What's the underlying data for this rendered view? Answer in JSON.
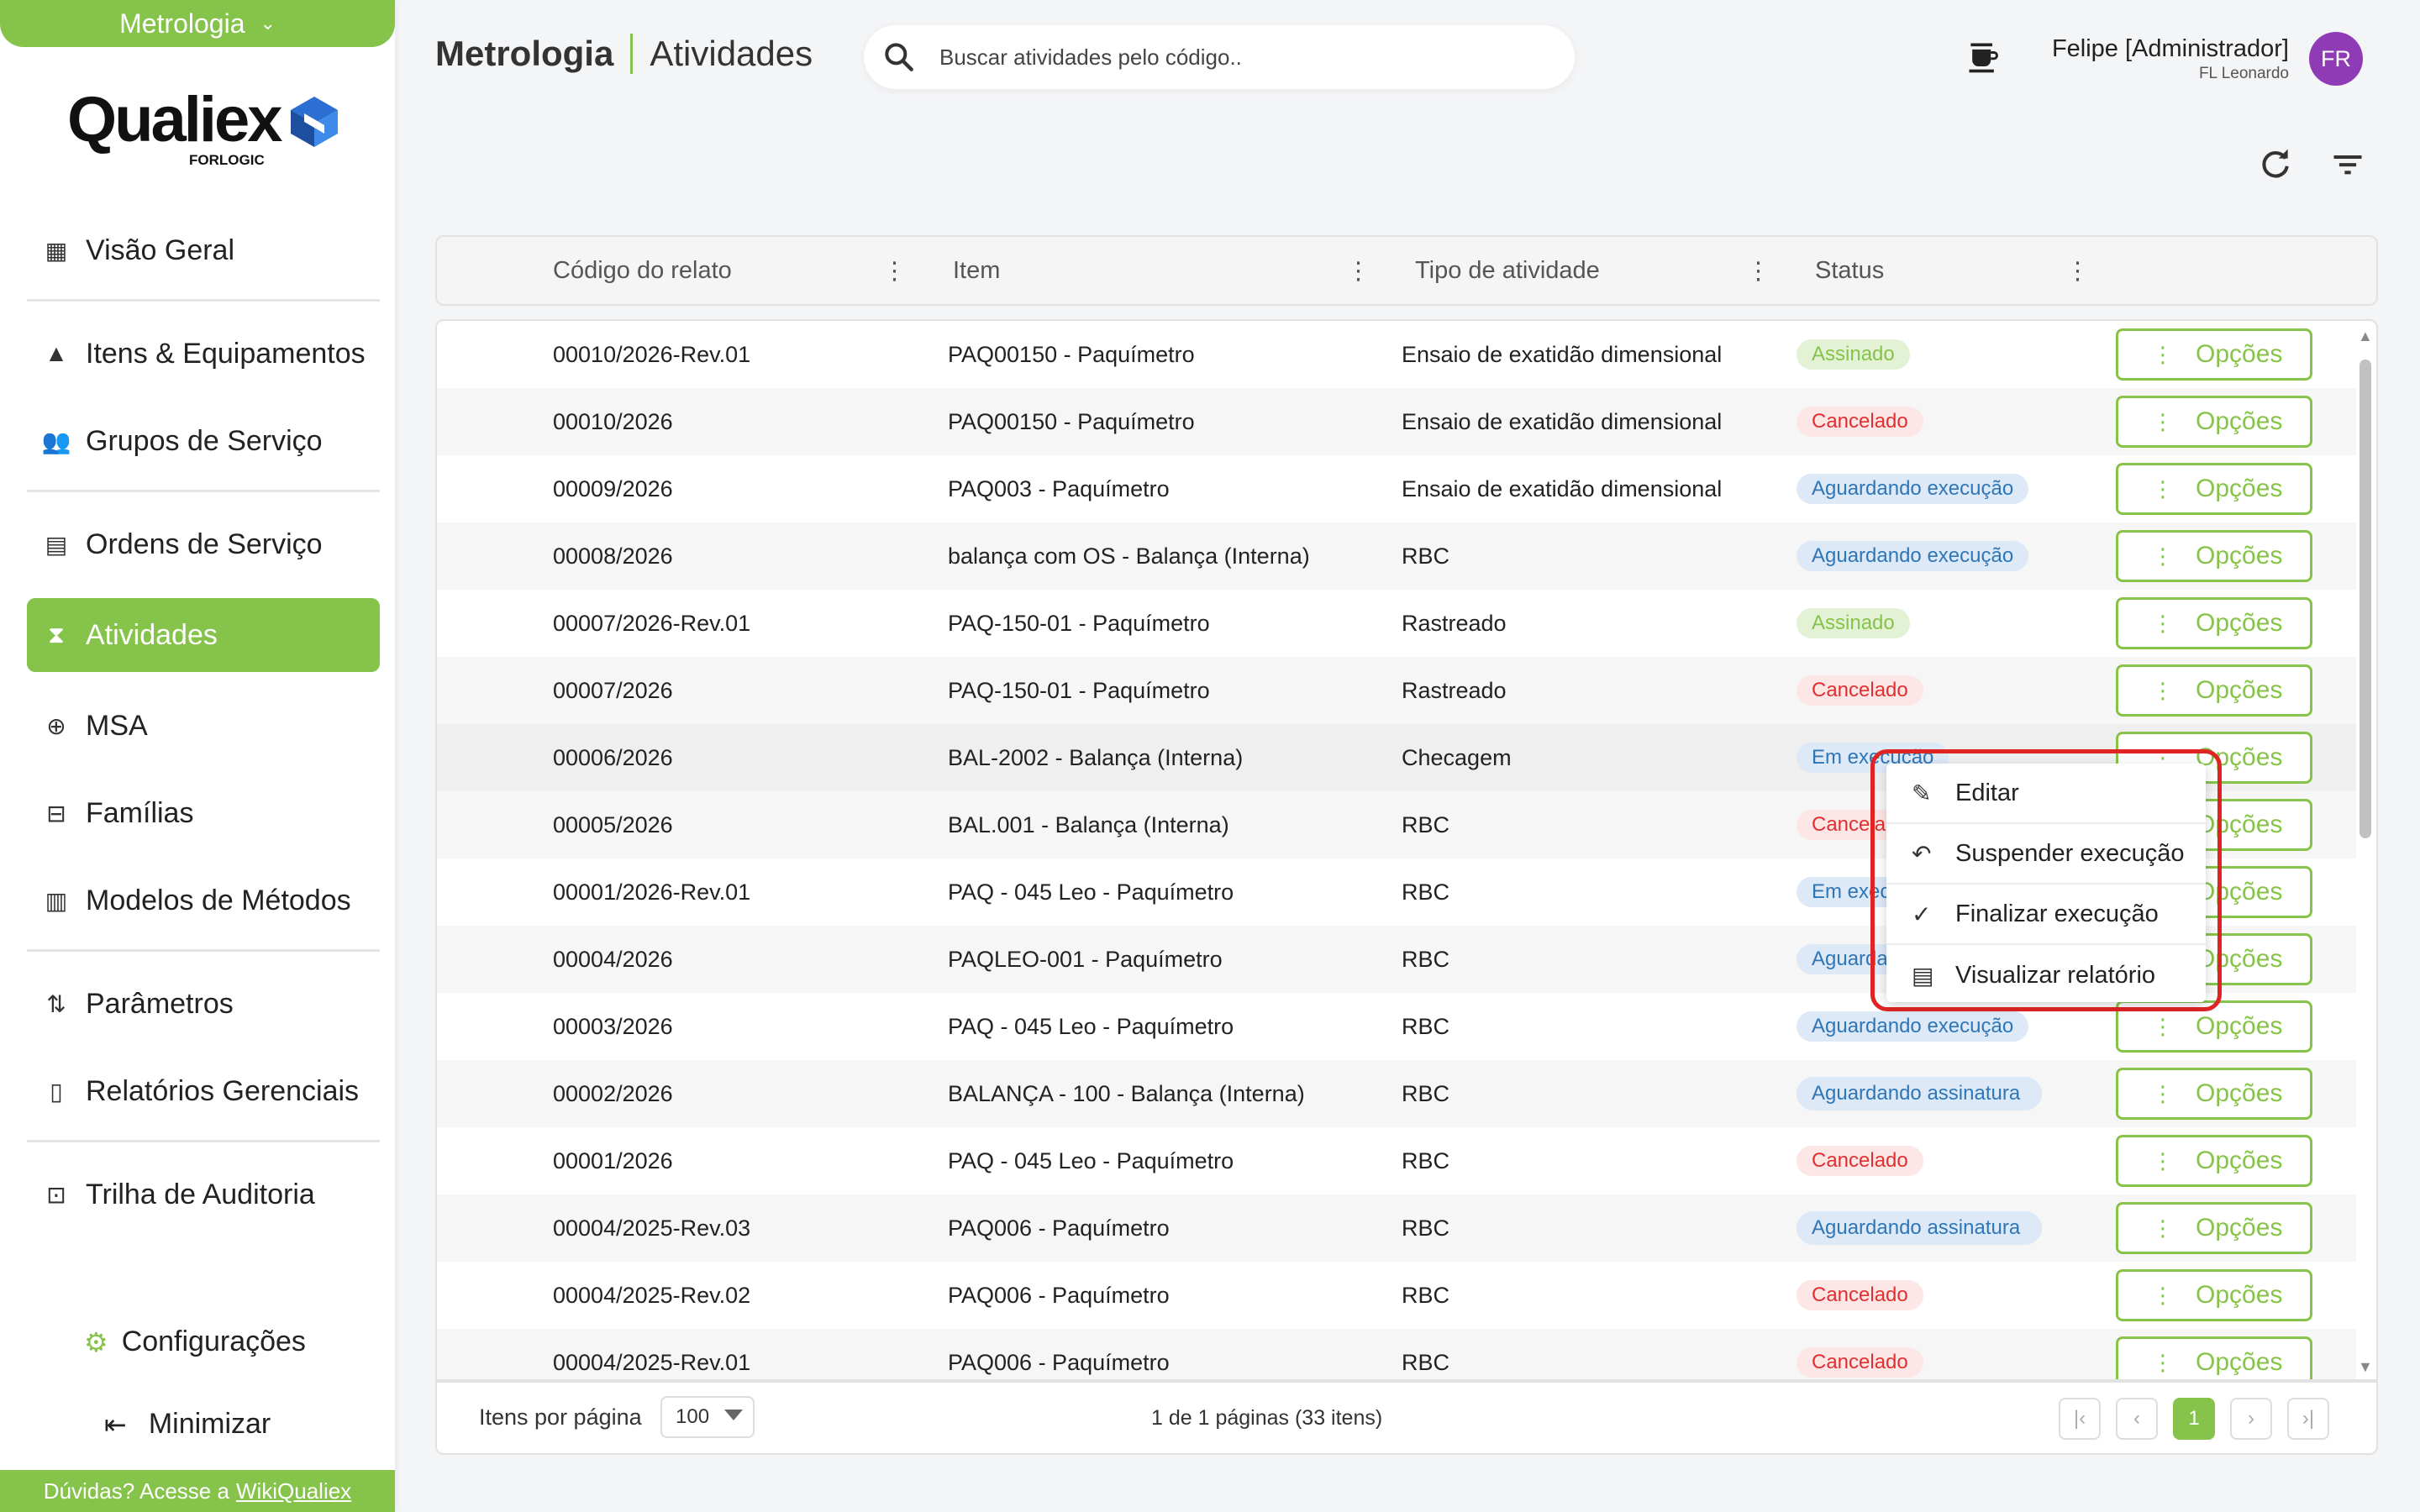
{
  "sidebar": {
    "module": "Metrologia",
    "logo": {
      "name": "Qualiex",
      "sub": "FORLOGIC"
    },
    "groups": [
      [
        {
          "label": "Visão Geral",
          "icon": "dashboard-icon"
        }
      ],
      [
        {
          "label": "Itens & Equipamentos",
          "icon": "shapes-icon"
        },
        {
          "label": "Grupos de Serviço",
          "icon": "group-icon"
        }
      ],
      [
        {
          "label": "Ordens de Serviço",
          "icon": "document-icon"
        },
        {
          "label": "Atividades",
          "icon": "hourglass-icon",
          "active": true
        },
        {
          "label": "MSA",
          "icon": "zoom-icon"
        },
        {
          "label": "Famílias",
          "icon": "toolbox-icon"
        },
        {
          "label": "Modelos de Métodos",
          "icon": "library-icon"
        }
      ],
      [
        {
          "label": "Parâmetros",
          "icon": "sliders-icon"
        },
        {
          "label": "Relatórios Gerenciais",
          "icon": "report-icon"
        }
      ],
      [
        {
          "label": "Trilha de Auditoria",
          "icon": "audit-icon"
        }
      ]
    ],
    "config_label": "Configurações",
    "minimize_label": "Minimizar",
    "help_text": "Dúvidas? Acesse a",
    "help_link": "WikiQualiex"
  },
  "header": {
    "module": "Metrologia",
    "page": "Atividades",
    "search_placeholder": "Buscar atividades pelo código..",
    "user_name": "Felipe [Administrador]",
    "user_org": "FL Leonardo",
    "avatar_initials": "FR"
  },
  "table": {
    "columns": [
      "Código do relato",
      "Item",
      "Tipo de atividade",
      "Status"
    ],
    "options_label": "Opções",
    "rows": [
      {
        "code": "00010/2026-Rev.01",
        "item": "PAQ00150 - Paquímetro",
        "type": "Ensaio de exatidão dimensional",
        "status": "Assinado",
        "kind": "signed"
      },
      {
        "code": "00010/2026",
        "item": "PAQ00150 - Paquímetro",
        "type": "Ensaio de exatidão dimensional",
        "status": "Cancelado",
        "kind": "cancel"
      },
      {
        "code": "00009/2026",
        "item": "PAQ003 - Paquímetro",
        "type": "Ensaio de exatidão dimensional",
        "status": "Aguardando execução",
        "kind": "waiting"
      },
      {
        "code": "00008/2026",
        "item": "balança com OS - Balança (Interna)",
        "type": "RBC",
        "status": "Aguardando execução",
        "kind": "waiting"
      },
      {
        "code": "00007/2026-Rev.01",
        "item": "PAQ-150-01 - Paquímetro",
        "type": "Rastreado",
        "status": "Assinado",
        "kind": "signed"
      },
      {
        "code": "00007/2026",
        "item": "PAQ-150-01 - Paquímetro",
        "type": "Rastreado",
        "status": "Cancelado",
        "kind": "cancel"
      },
      {
        "code": "00006/2026",
        "item": "BAL-2002 - Balança (Interna)",
        "type": "Checagem",
        "status": "Em execução",
        "kind": "running"
      },
      {
        "code": "00005/2026",
        "item": "BAL.001 - Balança (Interna)",
        "type": "RBC",
        "status": "Cancelado",
        "kind": "cancel"
      },
      {
        "code": "00001/2026-Rev.01",
        "item": "PAQ - 045 Leo - Paquímetro",
        "type": "RBC",
        "status": "Em execução",
        "kind": "running"
      },
      {
        "code": "00004/2026",
        "item": "PAQLEO-001 - Paquímetro",
        "type": "RBC",
        "status": "Aguardando execução",
        "kind": "waiting"
      },
      {
        "code": "00003/2026",
        "item": "PAQ - 045 Leo - Paquímetro",
        "type": "RBC",
        "status": "Aguardando execução",
        "kind": "waiting"
      },
      {
        "code": "00002/2026",
        "item": "BALANÇA - 100 - Balança (Interna)",
        "type": "RBC",
        "status": "Aguardando assinatura",
        "kind": "waiting2"
      },
      {
        "code": "00001/2026",
        "item": "PAQ - 045 Leo - Paquímetro",
        "type": "RBC",
        "status": "Cancelado",
        "kind": "cancel"
      },
      {
        "code": "00004/2025-Rev.03",
        "item": "PAQ006 - Paquímetro",
        "type": "RBC",
        "status": "Aguardando assinatura",
        "kind": "waiting2"
      },
      {
        "code": "00004/2025-Rev.02",
        "item": "PAQ006 - Paquímetro",
        "type": "RBC",
        "status": "Cancelado",
        "kind": "cancel"
      },
      {
        "code": "00004/2025-Rev.01",
        "item": "PAQ006 - Paquímetro",
        "type": "RBC",
        "status": "Cancelado",
        "kind": "cancel"
      }
    ]
  },
  "context_menu": {
    "items": [
      {
        "label": "Editar",
        "icon": "pencil-icon"
      },
      {
        "label": "Suspender execução",
        "icon": "undo-icon"
      },
      {
        "label": "Finalizar execução",
        "icon": "check-icon"
      },
      {
        "label": "Visualizar relatório",
        "icon": "clipboard-icon"
      }
    ]
  },
  "footer": {
    "items_per_page_label": "Itens por página",
    "items_per_page": "100",
    "page_info": "1 de 1 páginas (33 itens)",
    "current_page": "1"
  },
  "colors": {
    "accent": "#86c34a",
    "danger": "#e03030",
    "info": "#2f76b8",
    "highlight": "#e02424"
  }
}
